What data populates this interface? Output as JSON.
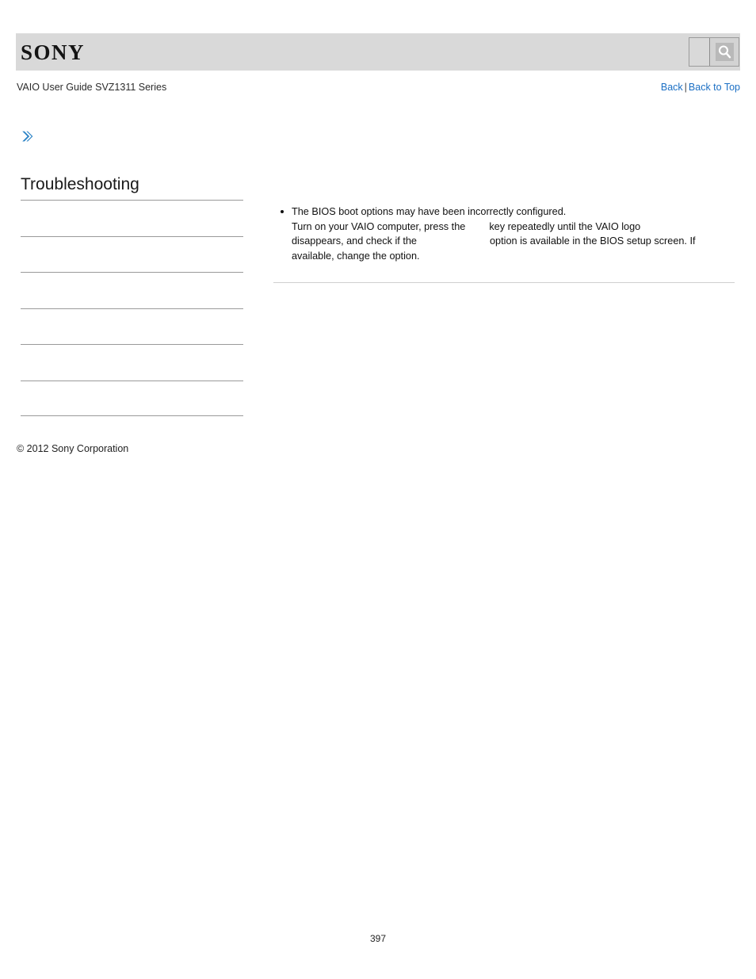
{
  "header": {
    "logo_text": "SONY",
    "search": {
      "value": "",
      "placeholder": "",
      "button_icon": "search-icon"
    }
  },
  "subheader": {
    "guide_title": "VAIO User Guide SVZ1311 Series",
    "back_label": "Back",
    "separator": "|",
    "back_to_top_label": "Back to Top"
  },
  "marker": {
    "icon": "double-chevron-right-icon",
    "color": "#2b83c6"
  },
  "sidebar": {
    "heading": "Troubleshooting",
    "items": [
      {
        "label": ""
      },
      {
        "label": ""
      },
      {
        "label": ""
      },
      {
        "label": ""
      },
      {
        "label": ""
      },
      {
        "label": ""
      }
    ]
  },
  "footer": {
    "copyright": "© 2012 Sony Corporation"
  },
  "main": {
    "bullets": [
      {
        "line1": "The BIOS boot options may have been incorrectly configured.",
        "line2_a": "Turn on your VAIO computer, press the",
        "line2_b": "key repeatedly until the VAIO logo",
        "line3_a": "disappears, and check if the",
        "line3_b": "option is available in the BIOS setup screen. If",
        "line4": "available, change the option."
      }
    ]
  },
  "page": {
    "number": "397"
  }
}
